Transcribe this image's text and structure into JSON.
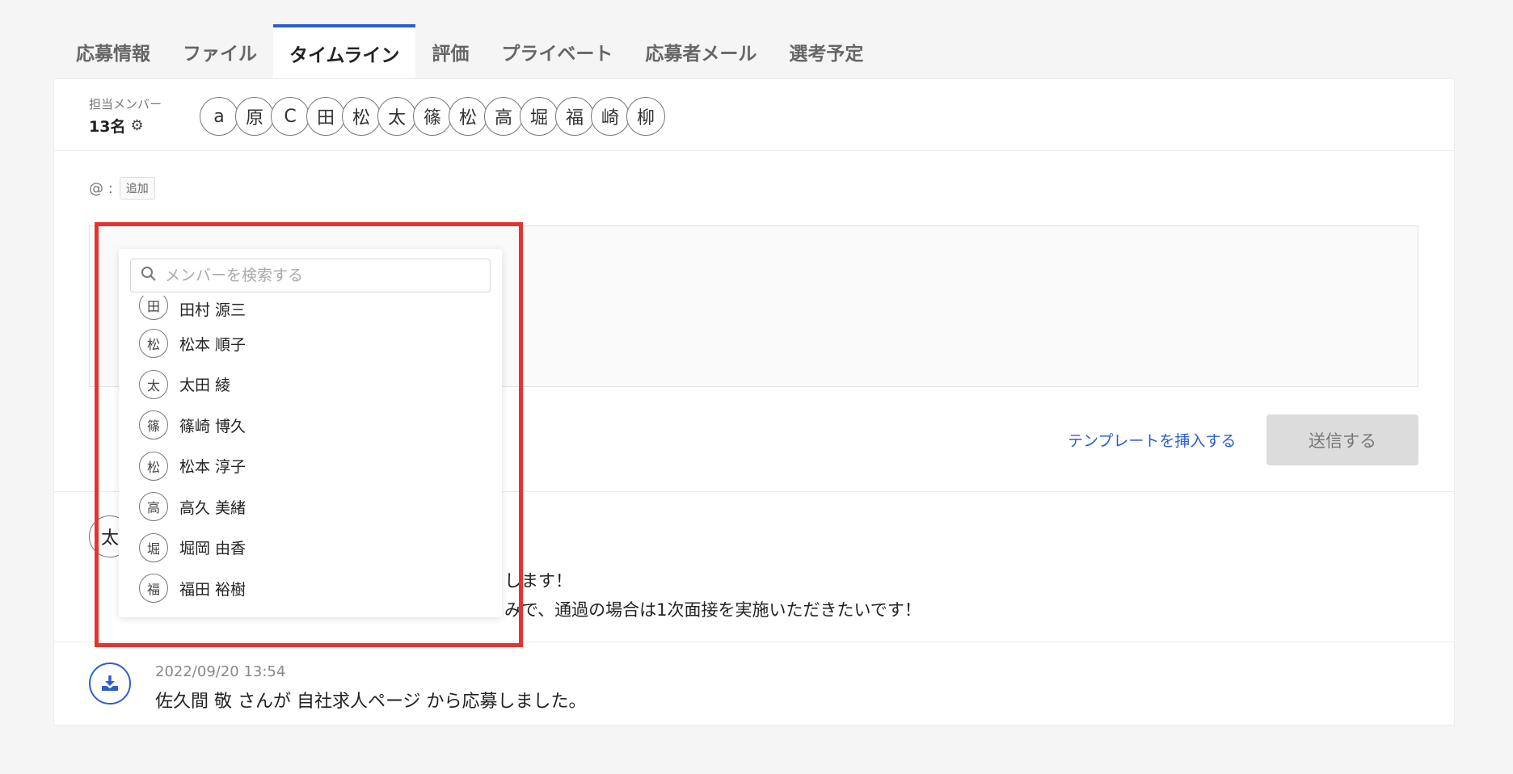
{
  "tabs": [
    {
      "label": "応募情報",
      "active": false
    },
    {
      "label": "ファイル",
      "active": false
    },
    {
      "label": "タイムライン",
      "active": true
    },
    {
      "label": "評価",
      "active": false
    },
    {
      "label": "プライベート",
      "active": false
    },
    {
      "label": "応募者メール",
      "active": false
    },
    {
      "label": "選考予定",
      "active": false
    }
  ],
  "members": {
    "title": "担当メンバー",
    "count": "13名",
    "avatars": [
      "a",
      "原",
      "C",
      "田",
      "松",
      "太",
      "篠",
      "松",
      "高",
      "堀",
      "福",
      "崎",
      "柳"
    ]
  },
  "mention": {
    "prefix": "@ :",
    "add_label": "追加"
  },
  "dropdown": {
    "search_placeholder": "メンバーを検索する",
    "items": [
      {
        "initial": "田",
        "name": "田村 源三"
      },
      {
        "initial": "松",
        "name": "松本 順子"
      },
      {
        "initial": "太",
        "name": "太田 綾"
      },
      {
        "initial": "篠",
        "name": "篠崎 博久"
      },
      {
        "initial": "松",
        "name": "松本 淳子"
      },
      {
        "initial": "高",
        "name": "高久 美緒"
      },
      {
        "initial": "堀",
        "name": "堀岡 由香"
      },
      {
        "initial": "福",
        "name": "福田 裕樹"
      }
    ]
  },
  "actions": {
    "template_label": "テンプレートを挿入する",
    "send_label": "送信する"
  },
  "timeline": {
    "comment_avatar": "太",
    "comment_line1": "します！",
    "comment_line2": "みで、通過の場合は1次面接を実施いただきたいです！",
    "event_time": "2022/09/20 13:54",
    "event_text": "佐久間 敬 さんが 自社求人ページ から応募しました。"
  },
  "colors": {
    "accent": "#2b5fc9",
    "highlight": "#e3342f"
  },
  "icons": {
    "settings": "gear-icon",
    "search": "search-icon",
    "download": "download-icon"
  }
}
